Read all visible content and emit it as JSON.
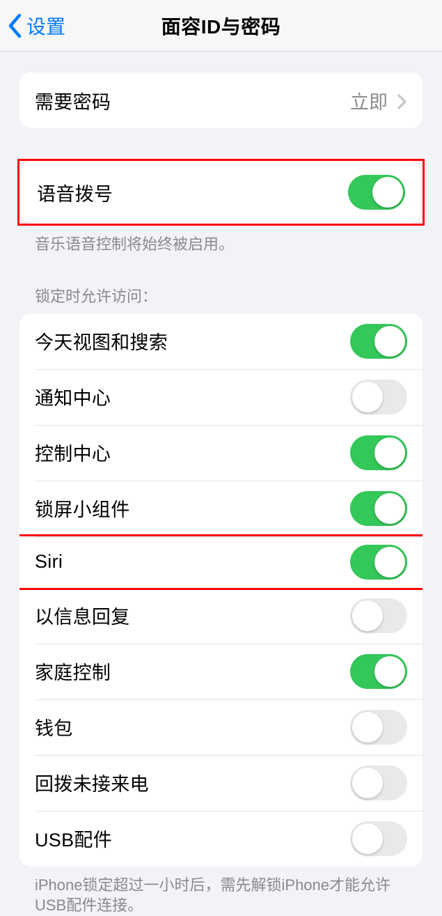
{
  "navbar": {
    "back_label": "设置",
    "title": "面容ID与密码"
  },
  "require_passcode": {
    "label": "需要密码",
    "value": "立即"
  },
  "voice_dial": {
    "label": "语音拨号",
    "enabled": true,
    "footer": "音乐语音控制将始终被启用。"
  },
  "locked_access": {
    "header": "锁定时允许访问：",
    "items": [
      {
        "label": "今天视图和搜索",
        "enabled": true
      },
      {
        "label": "通知中心",
        "enabled": false
      },
      {
        "label": "控制中心",
        "enabled": true
      },
      {
        "label": "锁屏小组件",
        "enabled": true
      },
      {
        "label": "Siri",
        "enabled": true
      },
      {
        "label": "以信息回复",
        "enabled": false
      },
      {
        "label": "家庭控制",
        "enabled": true
      },
      {
        "label": "钱包",
        "enabled": false
      },
      {
        "label": "回拨未接来电",
        "enabled": false
      },
      {
        "label": "USB配件",
        "enabled": false
      }
    ],
    "footer": "iPhone锁定超过一小时后，需先解锁iPhone才能允许USB配件连接。"
  }
}
